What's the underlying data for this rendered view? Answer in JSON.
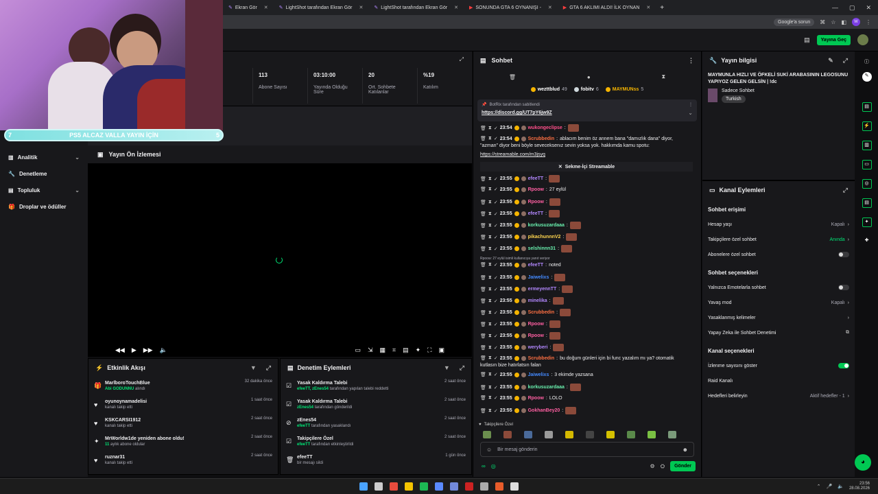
{
  "browser": {
    "tabs": [
      {
        "label": "Ekran Gör"
      },
      {
        "label": "LightShot tarafından Ekran Gör"
      },
      {
        "label": "LightShot tarafından Ekran Gör"
      },
      {
        "label": "SONUNDA GTA 6 OYNANIŞI -"
      },
      {
        "label": "GTA 6 AKLIMI ALDI! İLK OYNAN"
      }
    ],
    "google_chip": "Google'a sorun"
  },
  "topnav": {
    "go_live": "Yayına Geç"
  },
  "sidebar": {
    "items": [
      {
        "label": "Analitik",
        "has_chevron": true
      },
      {
        "label": "Denetleme",
        "has_chevron": false
      },
      {
        "label": "Topluluk",
        "has_chevron": true
      },
      {
        "label": "Droplar ve ödüller",
        "has_chevron": false
      }
    ]
  },
  "stats": [
    {
      "value": "113",
      "label": "Abone Sayısı"
    },
    {
      "value": "03:10:00",
      "label": "Yayında Olduğu Süre"
    },
    {
      "value": "20",
      "label": "Ort. Sohbete Katılanlar"
    },
    {
      "value": "%19",
      "label": "Katılım"
    }
  ],
  "overlay": {
    "banner_text": "PS5 ALCAZ VALLA YAYIN İÇİN",
    "banner_left": "7",
    "banner_right": "5"
  },
  "preview": {
    "title": "Yayın Ön İzlemesi"
  },
  "activity": {
    "title": "Etkinlik Akışı",
    "items": [
      {
        "user": "MarlboroTouchBlue",
        "desc_hl": "Abi GODUNNU",
        "desc": "alındı",
        "time": "32 dakika önce",
        "icon": "gift-icon"
      },
      {
        "user": "oyunoynamadelisi",
        "desc_hl": "",
        "desc": "kanalı takip etti",
        "time": "1 saat önce",
        "icon": "heart-icon"
      },
      {
        "user": "KSKCARSI1912",
        "desc_hl": "",
        "desc": "kanalı takip etti",
        "time": "2 saat önce",
        "icon": "heart-icon"
      },
      {
        "user": "MrWorldw1de yeniden abone oldu!",
        "desc_hl": "11",
        "desc": "aylık abone oldular",
        "time": "2 saat önce",
        "icon": "star-icon"
      },
      {
        "user": "ruznar31",
        "desc_hl": "",
        "desc": "kanalı takip etti",
        "time": "2 saat önce",
        "icon": "heart-icon"
      }
    ]
  },
  "moderation": {
    "title": "Denetim Eylemleri",
    "items": [
      {
        "title": "Yasak Kaldırma Talebi",
        "desc_hl": "efeeTT, zEnes54",
        "desc": "tarafından yapılan talebi reddetti",
        "time": "2 saat önce"
      },
      {
        "title": "Yasak Kaldırma Talebi",
        "desc_hl": "zEnes54",
        "desc": "tarafından gönderildi",
        "time": "2 saat önce"
      },
      {
        "title": "zEnes54",
        "desc_hl": "efeeTT",
        "desc": "tarafından yasaklandı",
        "time": "2 saat önce"
      },
      {
        "title": "Takipçilere Özel",
        "desc_hl": "efeeTT",
        "desc": "tarafından etkinleştirildi",
        "time": "2 saat önce"
      },
      {
        "title": "efeeTT",
        "desc_hl": "",
        "desc": "bir mesajı sildi",
        "time": "1 gün önce"
      }
    ]
  },
  "chat": {
    "title": "Sohbet",
    "leaders": [
      {
        "name": "wezttblud",
        "count": "49"
      },
      {
        "name": "fobitv",
        "count": "6"
      },
      {
        "name": "MAYMUNss",
        "count": "5"
      }
    ],
    "pinned_by": "BotRix tarafından sabitlendi",
    "pinned_link": "https://discord.gg/UT7pY6jw9Z",
    "streamable": "Sekme-İçi Streamable",
    "reply_hint": "Rpoow: 27 eylül isimli kullanıcıya yanıt veriyor",
    "messages": [
      {
        "time": "23:54",
        "user": "wukongeclipse",
        "color": "#ff4f8a",
        "text": ""
      },
      {
        "time": "23:54",
        "user": "Scrubbedin",
        "color": "#ff7043",
        "text": "ablacım benim öz annem bana \"damızlık dana\" diyor,"
      },
      {
        "time": "",
        "user": "",
        "color": "",
        "text": "\"azman\" diyor beni böyle seveceksenız sevin yoksa yok. hakkımda kamu spotu:"
      },
      {
        "time": "23:55",
        "user": "efeeTT",
        "color": "#b388ff",
        "text": ""
      },
      {
        "time": "23:55",
        "user": "Rpoow",
        "color": "#ff5fa2",
        "text": "27 eylül"
      },
      {
        "time": "23:55",
        "user": "Rpoow",
        "color": "#ff5fa2",
        "text": ""
      },
      {
        "time": "23:55",
        "user": "efeeTT",
        "color": "#b388ff",
        "text": ""
      },
      {
        "time": "23:55",
        "user": "korkusuzardaaa",
        "color": "#69f0ae",
        "text": ""
      },
      {
        "time": "23:55",
        "user": "pikachunnnV2",
        "color": "#ffd54f",
        "text": ""
      },
      {
        "time": "23:55",
        "user": "selshinnn31",
        "color": "#69f0ae",
        "text": ""
      },
      {
        "time": "23:55",
        "user": "efeeTT",
        "color": "#b388ff",
        "text": "noted"
      },
      {
        "time": "23:55",
        "user": "Jaiwelixs",
        "color": "#448aff",
        "text": ""
      },
      {
        "time": "23:55",
        "user": "ermeyennTT",
        "color": "#b388ff",
        "text": ""
      },
      {
        "time": "23:55",
        "user": "minelika",
        "color": "#b388ff",
        "text": ""
      },
      {
        "time": "23:55",
        "user": "Scrubbedin",
        "color": "#ff7043",
        "text": ""
      },
      {
        "time": "23:55",
        "user": "Rpoow",
        "color": "#ff5fa2",
        "text": ""
      },
      {
        "time": "23:55",
        "user": "Rpoow",
        "color": "#ff5fa2",
        "text": ""
      },
      {
        "time": "23:55",
        "user": "weryberi",
        "color": "#b388ff",
        "text": ""
      },
      {
        "time": "23:55",
        "user": "Scrubbedin",
        "color": "#ff7043",
        "text": "bu doğum günleri için bi func yazalım mı ya? otomatik"
      },
      {
        "time": "",
        "user": "",
        "color": "",
        "text": "kutlasın bize hatırlatsın falan"
      },
      {
        "time": "23:55",
        "user": "Jaiwelixs",
        "color": "#448aff",
        "text": "3 ekimde yazsana"
      },
      {
        "time": "23:55",
        "user": "korkusuzardaaa",
        "color": "#69f0ae",
        "text": ""
      },
      {
        "time": "23:55",
        "user": "Rpoow",
        "color": "#ff5fa2",
        "text": "LOLO"
      },
      {
        "time": "23:55",
        "user": "GokhanBey20",
        "color": "#ff5fa2",
        "text": ""
      }
    ],
    "link2": "https://streamable.com/m3jsyq",
    "followers_only": "Takipçilere Özel",
    "input_placeholder": "Bir mesaj gönderin",
    "send": "Gönder"
  },
  "stream_info": {
    "title": "Yayın bilgisi",
    "stream_title": "MAYMUNLA HIZLI VE ÖFKELİ SUKİ ARABASININ LEGOSUNU YAPIYOZ GELEN GELSİN | !dc",
    "category": "Sadece Sohbet",
    "tag": "Turkish"
  },
  "channel_actions": {
    "title": "Kanal Eylemleri",
    "sections": [
      {
        "title": "Sohbet erişimi",
        "rows": [
          {
            "label": "Hesap yaşı",
            "value": "Kapalı",
            "kind": "chevron"
          },
          {
            "label": "Takipçilere özel sohbet",
            "value": "Anında",
            "kind": "chevron-green"
          },
          {
            "label": "Abonelere özel sohbet",
            "value": "",
            "kind": "toggle-off"
          }
        ]
      },
      {
        "title": "Sohbet seçenekleri",
        "rows": [
          {
            "label": "Yalnızca Emotelarla sohbet",
            "value": "",
            "kind": "toggle-off"
          },
          {
            "label": "Yavaş mod",
            "value": "Kapalı",
            "kind": "chevron"
          },
          {
            "label": "Yasaklanmış kelimeler",
            "value": "",
            "kind": "chevron"
          },
          {
            "label": "Yapay Zeka ile Sohbet Denetimi",
            "value": "",
            "kind": "external"
          }
        ]
      },
      {
        "title": "Kanal seçenekleri",
        "rows": [
          {
            "label": "İzlenme sayısını göster",
            "value": "",
            "kind": "toggle-on"
          },
          {
            "label": "Raid Kanalı",
            "value": "",
            "kind": "none"
          },
          {
            "label": "Hedefleri belirleyin",
            "value": "Aktif hedefler - 1",
            "kind": "chevron"
          }
        ]
      }
    ]
  },
  "taskbar": {
    "time": "23:56",
    "date": "28.08.2026"
  },
  "colors": {
    "accent": "#00c853",
    "bg": "#0e0e10",
    "panel": "#18181b"
  }
}
